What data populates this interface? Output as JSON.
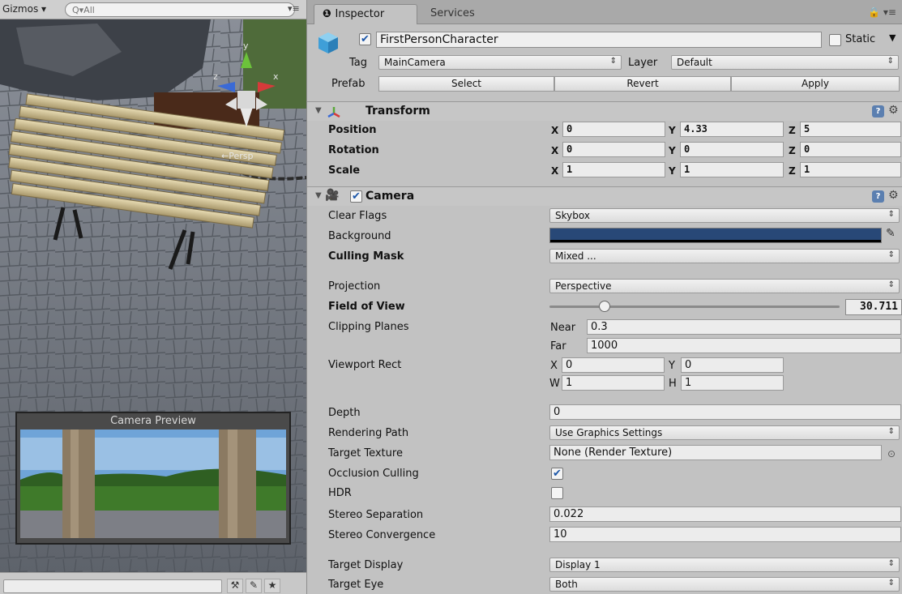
{
  "scene": {
    "gizmos_label": "Gizmos ▾",
    "search_placeholder": "Q▾All",
    "gizmo_axes": {
      "y": "y",
      "z": "z",
      "x": "x"
    },
    "persp_label": "←Persp",
    "camera_preview_title": "Camera Preview"
  },
  "tabs": {
    "inspector": "Inspector",
    "services": "Services"
  },
  "header": {
    "name": "FirstPersonCharacter",
    "active": true,
    "static_label": "Static",
    "static_checked": false,
    "tag_label": "Tag",
    "tag_value": "MainCamera",
    "layer_label": "Layer",
    "layer_value": "Default",
    "prefab_label": "Prefab",
    "select_label": "Select",
    "revert_label": "Revert",
    "apply_label": "Apply"
  },
  "transform": {
    "title": "Transform",
    "position_label": "Position",
    "rotation_label": "Rotation",
    "scale_label": "Scale",
    "axis_x": "X",
    "axis_y": "Y",
    "axis_z": "Z",
    "position": {
      "x": "0",
      "y": "4.33",
      "z": "5"
    },
    "rotation": {
      "x": "0",
      "y": "0",
      "z": "0"
    },
    "scale": {
      "x": "1",
      "y": "1",
      "z": "1"
    }
  },
  "camera": {
    "title": "Camera",
    "enabled": true,
    "clear_flags_label": "Clear Flags",
    "clear_flags_value": "Skybox",
    "background_label": "Background",
    "background_color": "#284877",
    "culling_mask_label": "Culling Mask",
    "culling_mask_value": "Mixed ...",
    "projection_label": "Projection",
    "projection_value": "Perspective",
    "fov_label": "Field of View",
    "fov_value": "30.711",
    "fov_fraction": 0.17,
    "clipping_label": "Clipping Planes",
    "near_label": "Near",
    "near_value": "0.3",
    "far_label": "Far",
    "far_value": "1000",
    "viewport_label": "Viewport Rect",
    "vp_x_label": "X",
    "vp_x": "0",
    "vp_y_label": "Y",
    "vp_y": "0",
    "vp_w_label": "W",
    "vp_w": "1",
    "vp_h_label": "H",
    "vp_h": "1",
    "depth_label": "Depth",
    "depth_value": "0",
    "rendering_path_label": "Rendering Path",
    "rendering_path_value": "Use Graphics Settings",
    "target_texture_label": "Target Texture",
    "target_texture_value": "None (Render Texture)",
    "occlusion_label": "Occlusion Culling",
    "occlusion_checked": true,
    "hdr_label": "HDR",
    "hdr_checked": false,
    "stereo_sep_label": "Stereo Separation",
    "stereo_sep_value": "0.022",
    "stereo_conv_label": "Stereo Convergence",
    "stereo_conv_value": "10",
    "target_display_label": "Target Display",
    "target_display_value": "Display 1",
    "target_eye_label": "Target Eye",
    "target_eye_value": "Both"
  }
}
